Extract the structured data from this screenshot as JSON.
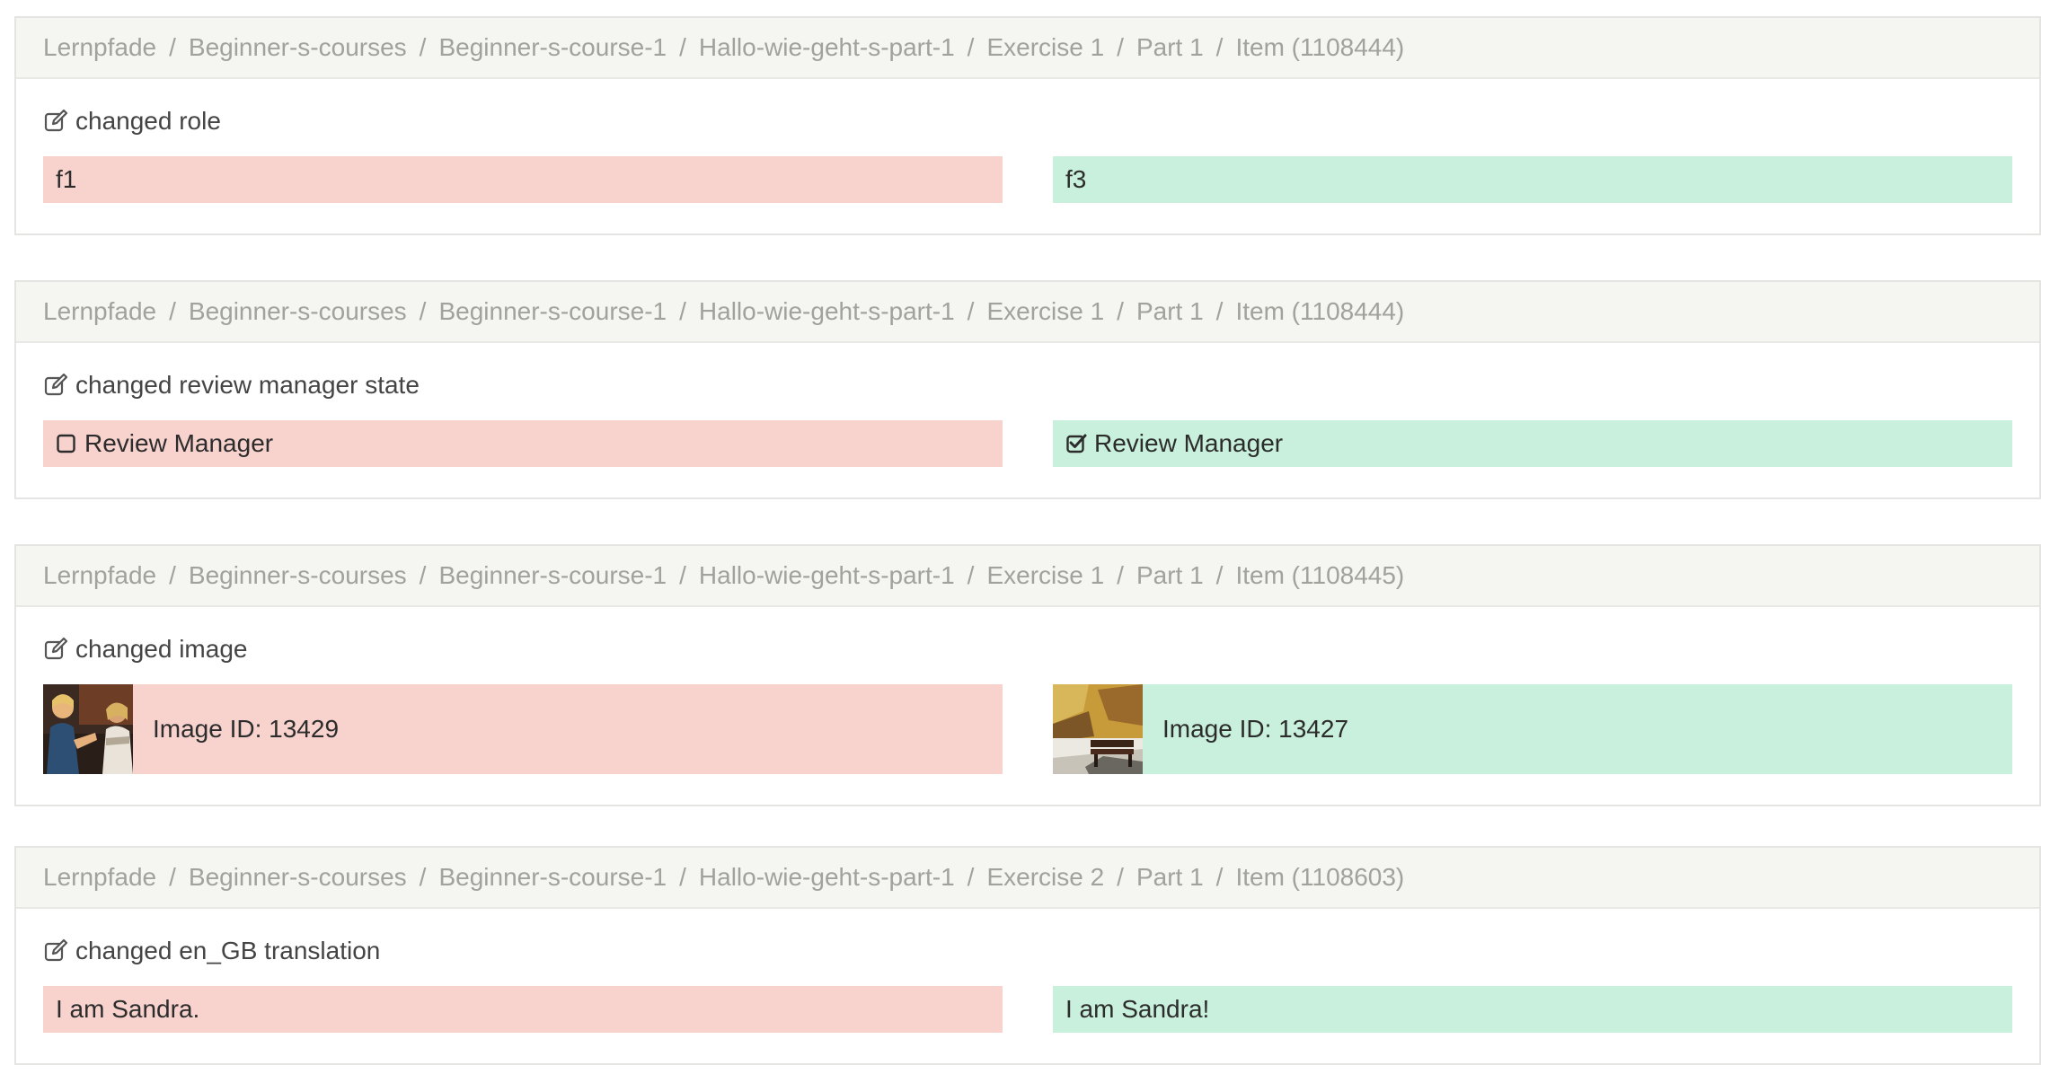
{
  "sep": "/",
  "panels": [
    {
      "breadcrumb": [
        "Lernpfade",
        "Beginner-s-courses",
        "Beginner-s-course-1",
        "Hallo-wie-geht-s-part-1",
        "Exercise 1",
        "Part 1",
        "Item (1108444)"
      ],
      "title": "changed role",
      "old": "f1",
      "new": "f3"
    },
    {
      "breadcrumb": [
        "Lernpfade",
        "Beginner-s-courses",
        "Beginner-s-course-1",
        "Hallo-wie-geht-s-part-1",
        "Exercise 1",
        "Part 1",
        "Item (1108444)"
      ],
      "title": "changed review manager state",
      "old": "Review Manager",
      "new": "Review Manager"
    },
    {
      "breadcrumb": [
        "Lernpfade",
        "Beginner-s-courses",
        "Beginner-s-course-1",
        "Hallo-wie-geht-s-part-1",
        "Exercise 1",
        "Part 1",
        "Item (1108445)"
      ],
      "title": "changed image",
      "old": "Image ID: 13429",
      "new": "Image ID: 13427"
    },
    {
      "breadcrumb": [
        "Lernpfade",
        "Beginner-s-courses",
        "Beginner-s-course-1",
        "Hallo-wie-geht-s-part-1",
        "Exercise 2",
        "Part 1",
        "Item (1108603)"
      ],
      "title": "changed en_GB translation",
      "old": "I am Sandra.",
      "new": "I am Sandra!"
    }
  ],
  "colors": {
    "old_bg": "#f8d3ce",
    "new_bg": "#c9f0dc",
    "header_bg": "#f5f5f1",
    "crumb_text": "#a2a29c"
  },
  "icons": {
    "title": "edit-icon",
    "old_checkbox": "checkbox-unchecked-icon",
    "new_checkbox": "checkbox-checked-icon"
  }
}
